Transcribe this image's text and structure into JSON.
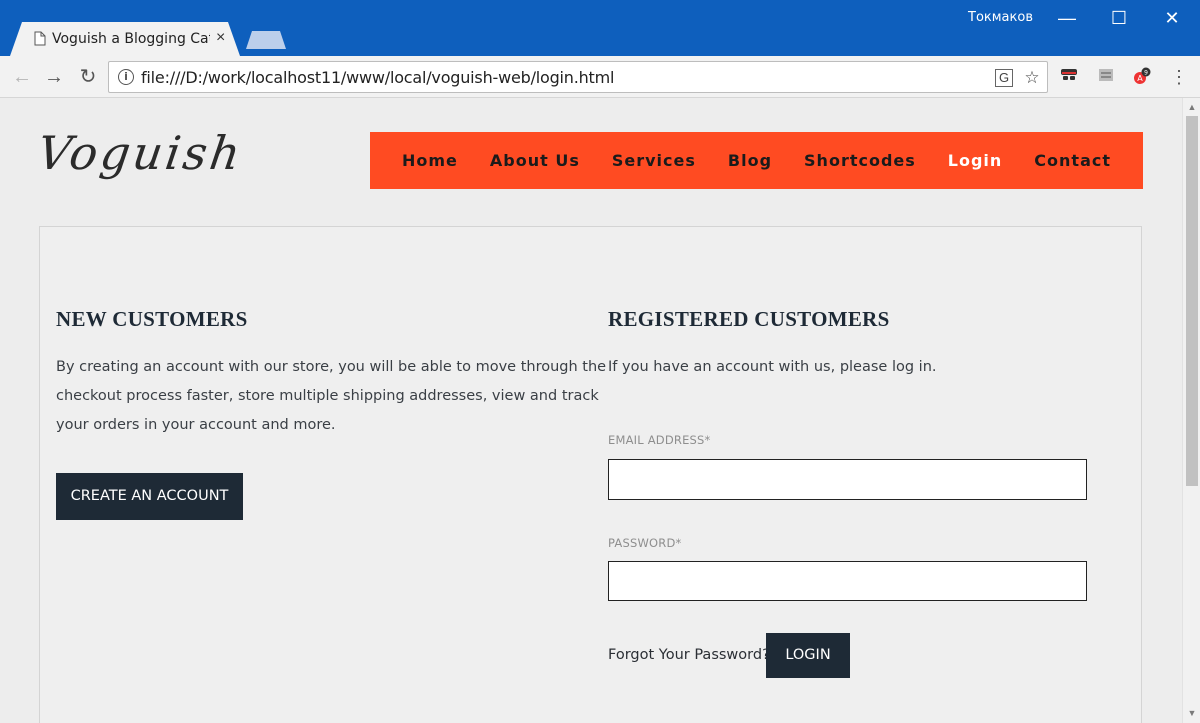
{
  "browser": {
    "tab_title": "Voguish a Blogging Categ",
    "tab_close": "×",
    "user_name": "Токмаков",
    "url": "file:///D:/work/localhost11/www/local/voguish-web/login.html",
    "minimize": "—",
    "maximize": "☐",
    "close": "✕"
  },
  "site": {
    "logo": "Voguish",
    "nav": [
      {
        "label": "Home",
        "active": false
      },
      {
        "label": "About Us",
        "active": false
      },
      {
        "label": "Services",
        "active": false
      },
      {
        "label": "Blog",
        "active": false
      },
      {
        "label": "Shortcodes",
        "active": false
      },
      {
        "label": "Login",
        "active": true
      },
      {
        "label": "Contact",
        "active": false
      }
    ],
    "accent_color": "#ff4b22",
    "dark_color": "#1e2a36"
  },
  "new_customers": {
    "title": "NEW CUSTOMERS",
    "line1": "By creating an account with our store, you will be able to move through the",
    "line2": "checkout process faster, store multiple shipping addresses, view and track",
    "line3": "your orders in your account and more.",
    "button": "CREATE AN ACCOUNT"
  },
  "registered": {
    "title": "REGISTERED CUSTOMERS",
    "text": "If you have an account with us, please log in.",
    "email_label": "EMAIL ADDRESS*",
    "email_value": "",
    "password_label": "PASSWORD*",
    "password_value": "",
    "forgot": "Forgot Your Password?",
    "login_button": "LOGIN"
  }
}
